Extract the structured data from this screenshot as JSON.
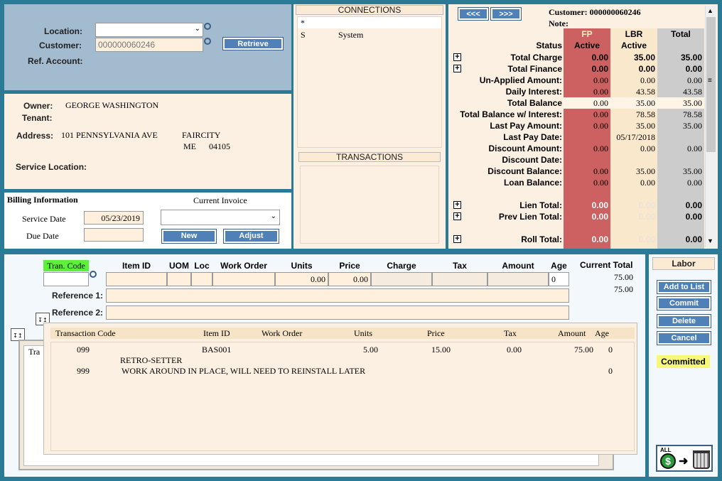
{
  "search": {
    "location_label": "Location:",
    "customer_label": "Customer:",
    "customer_value": "000000060246",
    "ref_label": "Ref. Account:",
    "retrieve": "Retrieve"
  },
  "owner": {
    "owner_label": "Owner:",
    "owner_value": "GEORGE WASHINGTON",
    "tenant_label": "Tenant:",
    "address_label": "Address:",
    "address_value": "101 PENNSYLVANIA AVE",
    "city": "FAIRCITY",
    "state": "ME",
    "zip": "04105",
    "service_label": "Service Location:"
  },
  "billing": {
    "title": "Billing Information",
    "current_invoice": "Current Invoice",
    "service_date_label": "Service Date",
    "service_date": "05/23/2019",
    "due_date_label": "Due Date",
    "new": "New",
    "adjust": "Adjust"
  },
  "connections": {
    "title": "CONNECTIONS",
    "rows": [
      {
        "code": "*",
        "name": ""
      },
      {
        "code": "S",
        "name": "System"
      }
    ],
    "transactions_title": "TRANSACTIONS"
  },
  "summary": {
    "prev": "<<<",
    "next": ">>>",
    "customer": "Customer: 000000060246",
    "note": "Note:",
    "cols": [
      {
        "code": "FP",
        "status": "Active"
      },
      {
        "code": "LBR",
        "status": "Active"
      },
      {
        "code": "Total",
        "status": ""
      }
    ],
    "status_label": "Status",
    "rows": [
      {
        "label": "Total Charge",
        "fp": "0.00",
        "lbr": "35.00",
        "total": "35.00",
        "bold": true,
        "plus": true
      },
      {
        "label": "Total Finance",
        "fp": "0.00",
        "lbr": "0.00",
        "total": "0.00",
        "bold": true,
        "plus": true
      },
      {
        "label": "Un-Applied Amount:",
        "fp": "0.00",
        "lbr": "0.00",
        "total": "0.00",
        "bold": false,
        "plus": false
      },
      {
        "label": "Daily Interest:",
        "fp": "0.00",
        "lbr": "43.58",
        "total": "43.58",
        "bold": false,
        "plus": false
      },
      {
        "label": "Total Balance",
        "fp": "0.00",
        "lbr": "35.00",
        "total": "35.00",
        "bold": false,
        "plus": false,
        "hl": true
      },
      {
        "label": "Total Balance w/ Interest:",
        "fp": "0.00",
        "lbr": "78.58",
        "total": "78.58",
        "bold": false,
        "plus": false
      },
      {
        "label": "Last Pay Amount:",
        "fp": "0.00",
        "lbr": "35.00",
        "total": "35.00",
        "bold": false,
        "plus": false
      },
      {
        "label": "Last Pay Date:",
        "fp": "",
        "lbr": "05/17/2018",
        "total": "",
        "bold": false,
        "plus": false
      },
      {
        "label": "Discount Amount:",
        "fp": "0.00",
        "lbr": "0.00",
        "total": "0.00",
        "bold": false,
        "plus": false
      },
      {
        "label": "Discount Date:",
        "fp": "",
        "lbr": "",
        "total": "",
        "bold": false,
        "plus": false
      },
      {
        "label": "Discount Balance:",
        "fp": "0.00",
        "lbr": "35.00",
        "total": "35.00",
        "bold": false,
        "plus": false
      },
      {
        "label": "Loan Balance:",
        "fp": "0.00",
        "lbr": "0.00",
        "total": "0.00",
        "bold": false,
        "plus": false
      },
      {
        "label": "",
        "fp": "",
        "lbr": "",
        "total": "",
        "bold": false,
        "plus": false
      },
      {
        "label": "Lien Total:",
        "fp": "0.00",
        "lbr": "0.00",
        "total": "0.00",
        "bold": true,
        "plus": true,
        "faint": true
      },
      {
        "label": "Prev Lien Total:",
        "fp": "0.00",
        "lbr": "0.00",
        "total": "0.00",
        "bold": true,
        "plus": true,
        "faint": true
      },
      {
        "label": "",
        "fp": "",
        "lbr": "",
        "total": "",
        "bold": false,
        "plus": false
      },
      {
        "label": "Roll Total:",
        "fp": "0.00",
        "lbr": "0.00",
        "total": "0.00",
        "bold": true,
        "plus": true,
        "faint": true
      }
    ]
  },
  "entry": {
    "tran_code": "Tran. Code",
    "headers": [
      "Item ID",
      "UOM",
      "Loc",
      "Work Order",
      "Units",
      "Price",
      "Charge",
      "Tax",
      "Amount",
      "Age"
    ],
    "units": "0.00",
    "price": "0.00",
    "age": "0",
    "current_total_label": "Current Total",
    "current_total_1": "75.00",
    "current_total_2": "75.00",
    "ref1": "Reference 1:",
    "ref2": "Reference 2:",
    "tra": "Tra"
  },
  "table": {
    "headers": [
      "Transaction Code",
      "Item ID",
      "Work Order",
      "Units",
      "Price",
      "Tax",
      "Amount",
      "Age"
    ],
    "rows": [
      {
        "code": "099",
        "item": "BAS001",
        "units": "5.00",
        "price": "15.00",
        "tax": "0.00",
        "amount": "75.00",
        "age": "0",
        "desc": "RETRO-SETTER"
      },
      {
        "code": "999",
        "item": "",
        "units": "",
        "price": "",
        "tax": "",
        "amount": "",
        "age": "0",
        "desc": "WORK AROUND IN PLACE, WILL NEED TO REINSTALL LATER"
      }
    ]
  },
  "side": {
    "labor": "Labor",
    "add": "Add to List",
    "commit": "Commit",
    "delete": "Delete",
    "cancel": "Cancel",
    "status": "Committed",
    "all": "ALL"
  },
  "colors": {
    "search_bg": "#a2bbce",
    "tan": "#fbf0e2",
    "fp": "#cd6060",
    "lbr": "#f9e8cc",
    "total": "#cccccc",
    "accent": "#4f81b8",
    "green": "#5cf03a",
    "yellow": "#f7f77a"
  }
}
